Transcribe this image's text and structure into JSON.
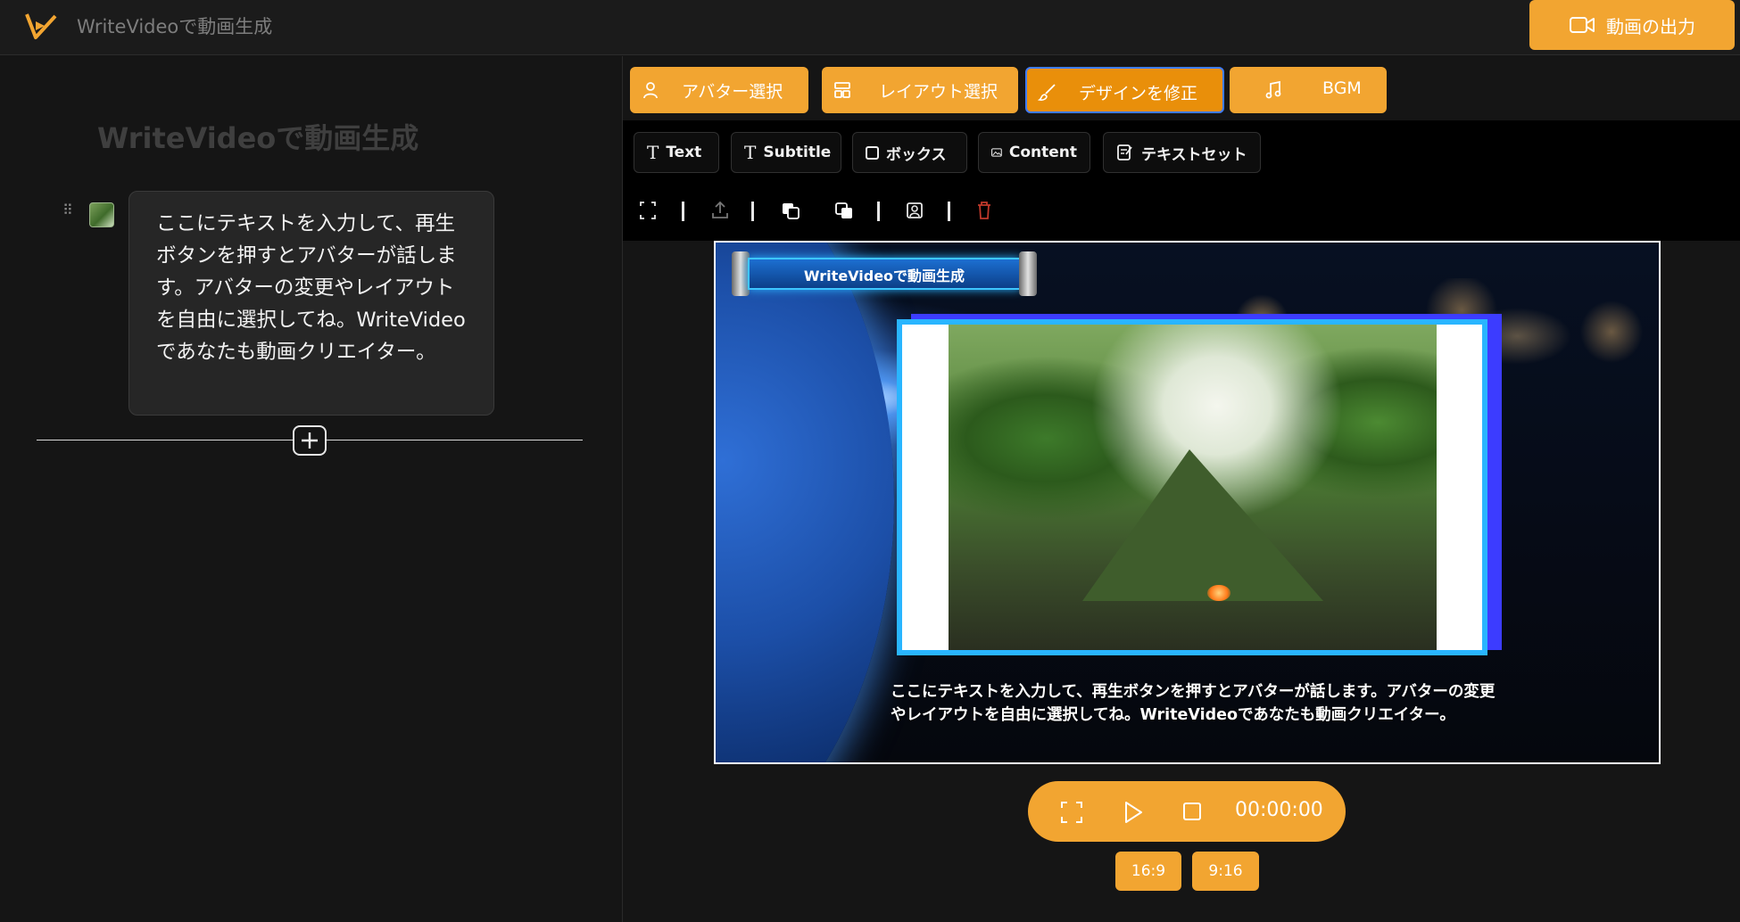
{
  "app": {
    "title": "WriteVideoで動画生成",
    "export_label": "動画の出力",
    "logo_icon": "writevideo-logo-icon",
    "accent_color": "#f2a531"
  },
  "left": {
    "heading": "WriteVideoで動画生成",
    "script_text": "ここにテキストを入力して、再生ボタンを押すとアバターが話します。アバターの変更やレイアウトを自由に選択してね。WriteVideoであなたも動画クリエイター。",
    "add_icon": "plus-icon"
  },
  "tabs": [
    {
      "label": "アバター選択",
      "icon": "user-icon"
    },
    {
      "label": "レイアウト選択",
      "icon": "layout-icon"
    },
    {
      "label": "デザインを修正",
      "icon": "brush-icon",
      "active": true
    },
    {
      "label": "BGM",
      "icon": "music-icon"
    }
  ],
  "tools": [
    {
      "label": "Text",
      "icon": "text-icon"
    },
    {
      "label": "Subtitle",
      "icon": "text-icon"
    },
    {
      "label": "ボックス",
      "icon": "box-icon"
    },
    {
      "label": "Content",
      "icon": "image-icon"
    },
    {
      "label": "テキストセット",
      "icon": "text-set-icon"
    }
  ],
  "icon_tools": [
    "fullscreen-icon",
    "upload-icon",
    "bring-forward-icon",
    "send-backward-icon",
    "avatar-frame-icon",
    "trash-icon"
  ],
  "stage": {
    "banner_title": "WriteVideoで動画生成",
    "subtitle": "ここにテキストを入力して、再生ボタンを押すとアバターが話します。アバターの変更やレイアウトを自由に選択してね。WriteVideoであなたも動画クリエイター。"
  },
  "player": {
    "timecode": "00:00:00",
    "icons": [
      "fullscreen-icon",
      "play-icon",
      "stop-icon"
    ]
  },
  "ratios": [
    "16:9",
    "9:16"
  ]
}
